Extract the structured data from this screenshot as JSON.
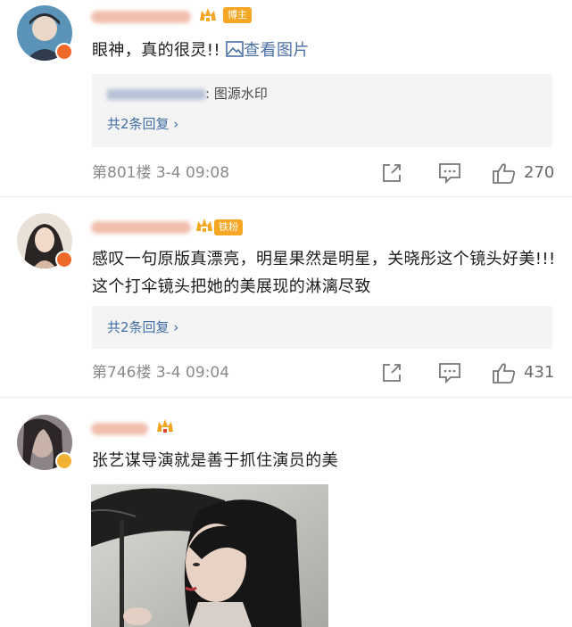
{
  "comments": [
    {
      "author_badge": "博主",
      "text": "眼神，真的很灵!!",
      "view_image_label": "查看图片",
      "reply_preview_suffix": ": 图源水印",
      "reply_count_label": "共2条回复 ›",
      "floor_time": "第801楼  3-4 09:08",
      "likes": "270"
    },
    {
      "author_badge": "铁粉",
      "text": "感叹一句原版真漂亮，明星果然是明星，关晓彤这个镜头好美!!! 这个打伞镜头把她的美展现的淋漓尽致",
      "reply_count_label": "共2条回复 ›",
      "floor_time": "第746楼  3-4 09:04",
      "likes": "431"
    },
    {
      "text": "张艺谋导演就是善于抓住演员的美"
    }
  ],
  "colors": {
    "link": "#3e6ea6",
    "badge": "#f5a623",
    "meta": "#8a8a8a"
  }
}
